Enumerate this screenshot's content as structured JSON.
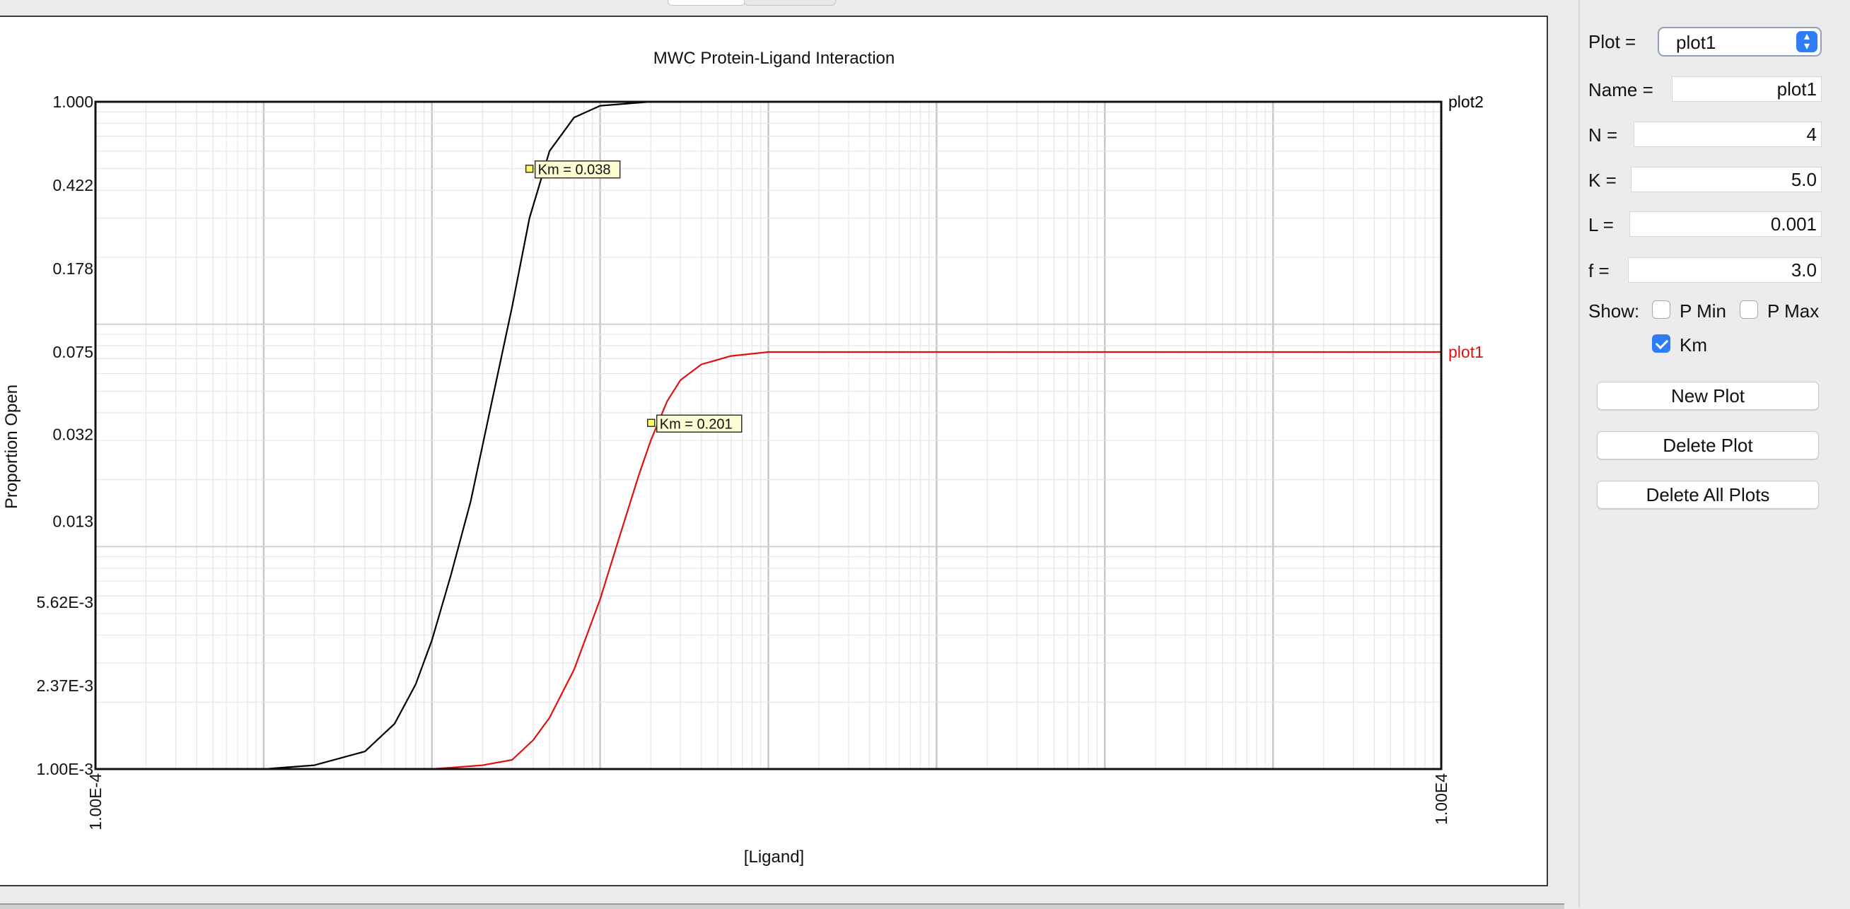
{
  "chart_data": {
    "type": "line",
    "title": "MWC Protein-Ligand Interaction",
    "xlabel": "[Ligand]",
    "ylabel": "Proportion Open",
    "x_scale": "log",
    "y_scale": "log",
    "xlim": [
      0.0001,
      10000
    ],
    "ylim": [
      0.001,
      1.0
    ],
    "grid": true,
    "x_tick_labels": [
      "1.00E-4",
      "1.00E4"
    ],
    "y_tick_labels": [
      "1.000",
      "0.422",
      "0.178",
      "0.075",
      "0.032",
      "0.013",
      "5.62E-3",
      "2.37E-3",
      "1.00E-3"
    ],
    "y_tick_values": [
      1.0,
      0.422,
      0.178,
      0.075,
      0.032,
      0.013,
      0.00562,
      0.00237,
      0.001
    ],
    "series": [
      {
        "name": "plot2",
        "color": "#000000",
        "x": [
          0.0001,
          0.001,
          0.002,
          0.004,
          0.006,
          0.008,
          0.01,
          0.013,
          0.017,
          0.022,
          0.03,
          0.038,
          0.05,
          0.07,
          0.1,
          0.2,
          10000
        ],
        "y": [
          0.001,
          0.001,
          0.00104,
          0.0012,
          0.0016,
          0.0024,
          0.0038,
          0.0075,
          0.016,
          0.04,
          0.12,
          0.3,
          0.6,
          0.85,
          0.96,
          1.0,
          1.0
        ],
        "annotations": [
          {
            "x": 0.038,
            "y": 0.5,
            "label": "Km = 0.038"
          }
        ]
      },
      {
        "name": "plot1",
        "color": "#e01010",
        "x": [
          0.0001,
          0.01,
          0.02,
          0.03,
          0.04,
          0.05,
          0.07,
          0.1,
          0.13,
          0.17,
          0.2,
          0.25,
          0.3,
          0.4,
          0.6,
          1.0,
          10000
        ],
        "y": [
          0.001,
          0.001,
          0.00104,
          0.0011,
          0.00135,
          0.0017,
          0.0028,
          0.0058,
          0.011,
          0.021,
          0.03,
          0.045,
          0.056,
          0.066,
          0.072,
          0.075,
          0.075
        ],
        "annotations": [
          {
            "x": 0.201,
            "y": 0.036,
            "label": "Km = 0.201"
          }
        ]
      }
    ]
  },
  "sidebar": {
    "plot_label": "Plot =",
    "plot_value": "plot1",
    "name_label": "Name =",
    "name_value": "plot1",
    "n_label": "N =",
    "n_value": "4",
    "k_label": "K =",
    "k_value": "5.0",
    "l_label": "L =",
    "l_value": "0.001",
    "f_label": "f =",
    "f_value": "3.0",
    "show_label": "Show:",
    "pmin_label": "P Min",
    "pmin_checked": false,
    "pmax_label": "P Max",
    "pmax_checked": false,
    "km_label": "Km",
    "km_checked": true,
    "new_plot": "New Plot",
    "delete_plot": "Delete Plot",
    "delete_all": "Delete All Plots"
  }
}
